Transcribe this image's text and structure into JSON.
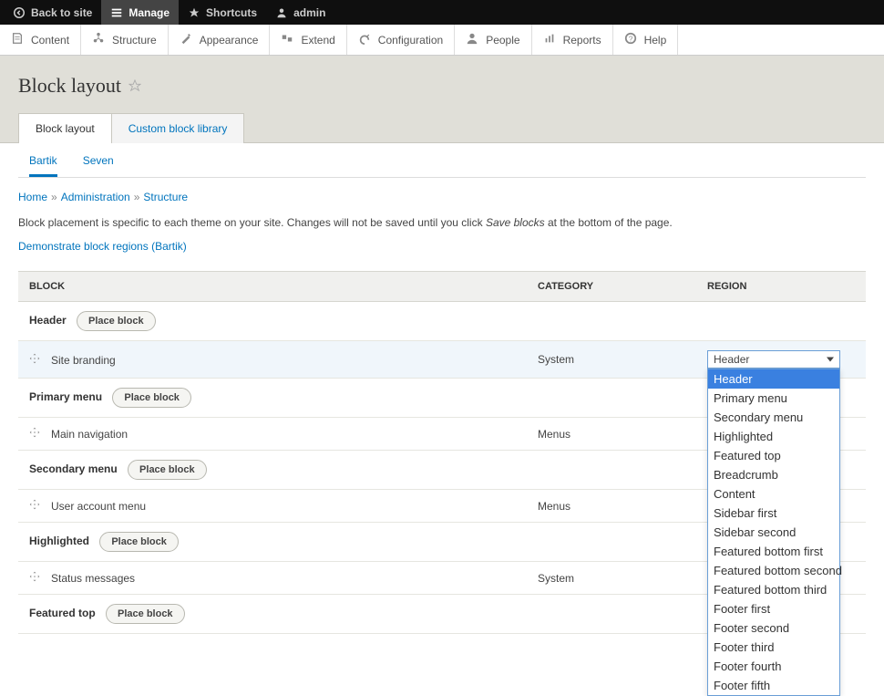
{
  "toolbar": {
    "back": "Back to site",
    "manage": "Manage",
    "shortcuts": "Shortcuts",
    "user": "admin"
  },
  "adminMenu": [
    {
      "label": "Content"
    },
    {
      "label": "Structure"
    },
    {
      "label": "Appearance"
    },
    {
      "label": "Extend"
    },
    {
      "label": "Configuration"
    },
    {
      "label": "People"
    },
    {
      "label": "Reports"
    },
    {
      "label": "Help"
    }
  ],
  "page": {
    "title": "Block layout"
  },
  "primaryTabs": [
    {
      "label": "Block layout",
      "active": true
    },
    {
      "label": "Custom block library",
      "active": false
    }
  ],
  "secondaryTabs": [
    {
      "label": "Bartik",
      "active": true
    },
    {
      "label": "Seven",
      "active": false
    }
  ],
  "breadcrumb": [
    {
      "label": "Home"
    },
    {
      "label": "Administration"
    },
    {
      "label": "Structure"
    }
  ],
  "descriptionPre": "Block placement is specific to each theme on your site. Changes will not be saved until you click ",
  "descriptionEm": "Save blocks",
  "descriptionPost": " at the bottom of the page.",
  "demoLink": "Demonstrate block regions (Bartik)",
  "tableHeaders": {
    "block": "BLOCK",
    "category": "CATEGORY",
    "region": "REGION"
  },
  "placeBlockLabel": "Place block",
  "regions": [
    {
      "name": "Header",
      "blocks": [
        {
          "name": "Site branding",
          "category": "System",
          "region": "Header",
          "highlight": true,
          "open": true
        }
      ]
    },
    {
      "name": "Primary menu",
      "blocks": [
        {
          "name": "Main navigation",
          "category": "Menus"
        }
      ]
    },
    {
      "name": "Secondary menu",
      "blocks": [
        {
          "name": "User account menu",
          "category": "Menus"
        }
      ]
    },
    {
      "name": "Highlighted",
      "blocks": [
        {
          "name": "Status messages",
          "category": "System"
        }
      ]
    },
    {
      "name": "Featured top",
      "blocks": []
    }
  ],
  "selectOptions": [
    "Header",
    "Primary menu",
    "Secondary menu",
    "Highlighted",
    "Featured top",
    "Breadcrumb",
    "Content",
    "Sidebar first",
    "Sidebar second",
    "Featured bottom first",
    "Featured bottom second",
    "Featured bottom third",
    "Footer first",
    "Footer second",
    "Footer third",
    "Footer fourth",
    "Footer fifth"
  ],
  "selectedOption": "Header"
}
